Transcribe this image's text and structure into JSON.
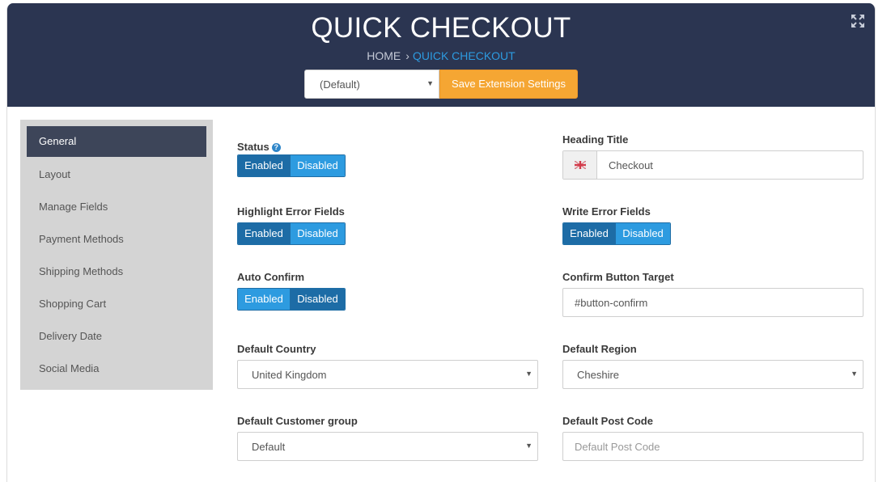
{
  "header": {
    "title": "QUICK CHECKOUT",
    "breadcrumb": {
      "home": "HOME",
      "separator": "›",
      "current": "QUICK CHECKOUT"
    },
    "store_select": "(Default)",
    "save_label": "Save Extension Settings",
    "caret": "▼",
    "expand_icon": "expand-arrows-icon"
  },
  "sidebar": {
    "items": [
      {
        "label": "General",
        "active": true
      },
      {
        "label": "Layout"
      },
      {
        "label": "Manage Fields"
      },
      {
        "label": "Payment Methods"
      },
      {
        "label": "Shipping Methods"
      },
      {
        "label": "Shopping Cart"
      },
      {
        "label": "Delivery Date"
      },
      {
        "label": "Social Media"
      }
    ]
  },
  "form": {
    "enabled_label": "Enabled",
    "disabled_label": "Disabled",
    "status": {
      "label": "Status",
      "help": "?",
      "value": "Enabled"
    },
    "highlight_error_fields": {
      "label": "Highlight Error Fields",
      "value": "Enabled"
    },
    "auto_confirm": {
      "label": "Auto Confirm",
      "value": "Disabled"
    },
    "heading_title": {
      "label": "Heading Title",
      "value": "Checkout",
      "flag_icon": "uk-flag-icon"
    },
    "write_error_fields": {
      "label": "Write Error Fields",
      "value": "Enabled"
    },
    "confirm_button_target": {
      "label": "Confirm Button Target",
      "value": "#button-confirm"
    },
    "default_country": {
      "label": "Default Country",
      "value": "United Kingdom"
    },
    "default_region": {
      "label": "Default Region",
      "value": "Cheshire"
    },
    "default_customer_group": {
      "label": "Default Customer group",
      "value": "Default"
    },
    "default_post_code": {
      "label": "Default Post Code",
      "value": "",
      "placeholder": "Default Post Code"
    }
  },
  "colors": {
    "header_bg": "#2b3551",
    "accent": "#f5a633",
    "link": "#2d9be0",
    "toggle_on": "#1d6ca6",
    "toggle_off": "#2d9be0",
    "sidebar_bg": "#d4d4d4",
    "sidebar_active": "#3d4559"
  }
}
